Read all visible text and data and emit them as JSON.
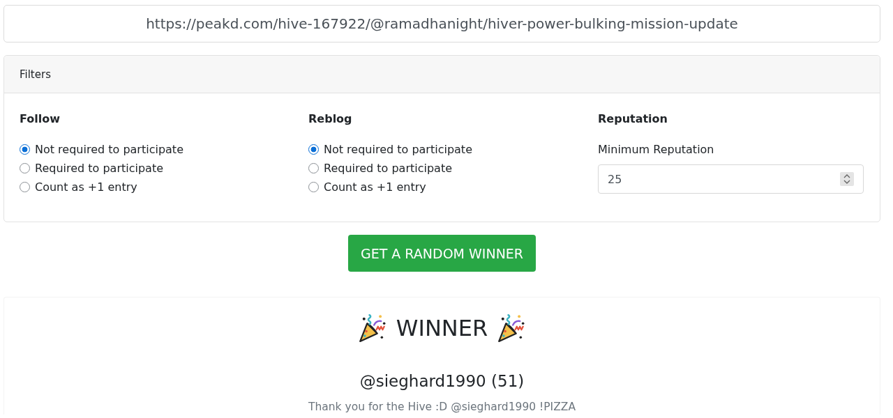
{
  "url_field": {
    "value": "https://peakd.com/hive-167922/@ramadhanight/hiver-power-bulking-mission-update"
  },
  "filters": {
    "title": "Filters",
    "groups": [
      {
        "kind": "radio",
        "title": "Follow",
        "options": [
          {
            "label": "Not required to participate",
            "selected": true
          },
          {
            "label": "Required to participate",
            "selected": false
          },
          {
            "label": "Count as +1 entry",
            "selected": false
          }
        ]
      },
      {
        "kind": "radio",
        "title": "Reblog",
        "options": [
          {
            "label": "Not required to participate",
            "selected": true
          },
          {
            "label": "Required to participate",
            "selected": false
          },
          {
            "label": "Count as +1 entry",
            "selected": false
          }
        ]
      },
      {
        "kind": "number",
        "title": "Reputation",
        "label": "Minimum Reputation",
        "value": "25"
      }
    ]
  },
  "action_button": {
    "label": "GET A RANDOM WINNER"
  },
  "winner": {
    "title": "WINNER",
    "name": "@sieghard1990 (51)",
    "message": "Thank you for the Hive :D @sieghard1990 !PIZZA"
  }
}
